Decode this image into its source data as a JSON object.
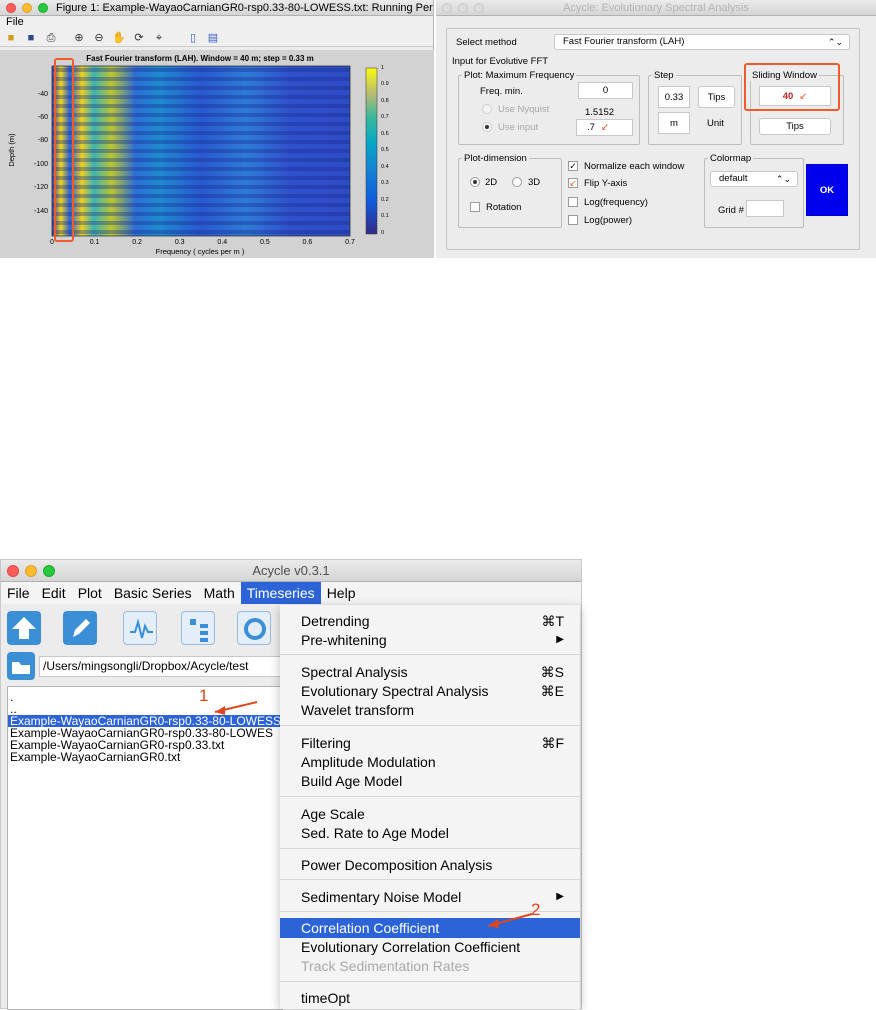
{
  "figure_window": {
    "title": "Figure 1: Example-WayaoCarnianGR0-rsp0.33-80-LOWESS.txt: Running Peri...",
    "menu_file": "File",
    "toolbar_icons": [
      "open-icon",
      "save-icon",
      "print-icon",
      "zoom-in-icon",
      "zoom-out-icon",
      "pan-icon",
      "rotate-icon",
      "data-cursor-icon",
      "colorbar-icon",
      "legend-icon"
    ],
    "plot": {
      "title": "Fast Fourier transform (LAH). Window = 40 m; step = 0.33 m",
      "ylabel": "Depth (m)",
      "xlabel": "Frequency ( cycles per m )",
      "x_ticks": [
        "0",
        "0.1",
        "0.2",
        "0.3",
        "0.4",
        "0.5",
        "0.6",
        "0.7"
      ],
      "y_ticks": [
        "-40",
        "-60",
        "-80",
        "-100",
        "-120",
        "-140"
      ],
      "colorbar_ticks": [
        "1",
        "0.9",
        "0.8",
        "0.7",
        "0.6",
        "0.5",
        "0.4",
        "0.3",
        "0.2",
        "0.1",
        "0"
      ]
    }
  },
  "esa_dialog": {
    "title": "Acycle: Evolutionary Spectral Analysis",
    "select_method_label": "Select method",
    "method_value": "Fast Fourier transform (LAH)",
    "input_group_label": "Input for Evolutive FFT",
    "plot_max_freq_label": "Plot: Maximum Frequency",
    "freq_min_label": "Freq. min.",
    "freq_min_value": "0",
    "use_nyquist_label": "Use Nyquist",
    "nyquist_value": "1.5152",
    "use_input_label": "Use input",
    "input_value": ".7",
    "step_group_label": "Step",
    "step_value": "0.33",
    "step_tips_label": "Tips",
    "step_unit_value": "m",
    "unit_label": "Unit",
    "sliding_window_label": "Sliding Window",
    "sliding_window_value": "40",
    "window_tips_label": "Tips",
    "plot_dimension_label": "Plot-dimension",
    "dim_2d_label": "2D",
    "dim_3d_label": "3D",
    "rotation_label": "Rotation",
    "normalize_label": "Normalize each window",
    "flip_y_label": "Flip Y-axis",
    "log_freq_label": "Log(frequency)",
    "log_power_label": "Log(power)",
    "colormap_label": "Colormap",
    "colormap_value": "default",
    "grid_label": "Grid #",
    "grid_value": "",
    "ok_label": "OK",
    "ok_color": "#0000ee"
  },
  "main_window": {
    "title": "Acycle v0.3.1",
    "menu": [
      "File",
      "Edit",
      "Plot",
      "Basic Series",
      "Math",
      "Timeseries",
      "Help"
    ],
    "active_menu": "Timeseries",
    "path": "/Users/mingsongli/Dropbox/Acycle/test",
    "files": [
      ".",
      "..",
      "Example-WayaoCarnianGR0-rsp0.33-80-LOWESS",
      "Example-WayaoCarnianGR0-rsp0.33-80-LOWES",
      "Example-WayaoCarnianGR0-rsp0.33.txt",
      "Example-WayaoCarnianGR0.txt"
    ],
    "selected_file_index": 2,
    "annotation_1": "1",
    "annotation_2": "2"
  },
  "timeseries_menu": {
    "detrending": "Detrending",
    "detrending_sc": "⌘T",
    "prewhitening": "Pre-whitening",
    "spectral": "Spectral Analysis",
    "spectral_sc": "⌘S",
    "evolutionary": "Evolutionary Spectral Analysis",
    "evolutionary_sc": "⌘E",
    "wavelet": "Wavelet transform",
    "filtering": "Filtering",
    "filtering_sc": "⌘F",
    "amplitude": "Amplitude Modulation",
    "build_age": "Build Age Model",
    "age_scale": "Age Scale",
    "sed_rate": "Sed. Rate to Age Model",
    "power_decomp": "Power Decomposition Analysis",
    "sed_noise": "Sedimentary Noise Model",
    "correlation": "Correlation Coefficient",
    "evo_correlation": "Evolutionary Correlation Coefficient",
    "track_sed": "Track Sedimentation Rates",
    "timeopt": "timeOpt",
    "submenu_arrow": "▶"
  }
}
